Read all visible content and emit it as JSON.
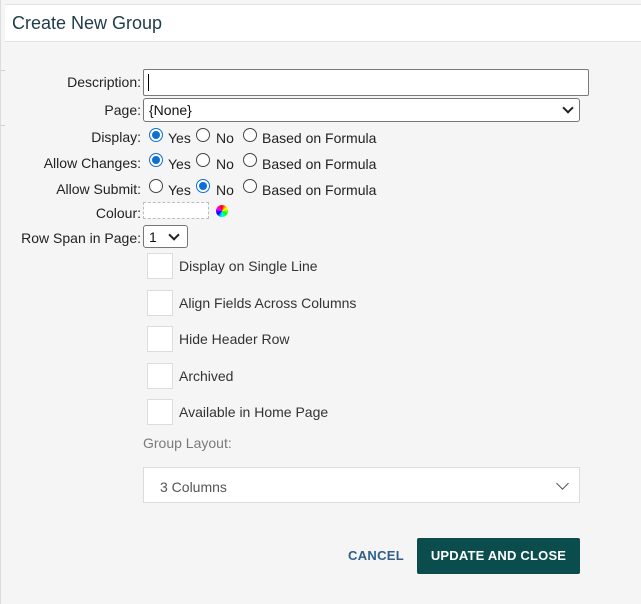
{
  "dialog": {
    "title": "Create New Group"
  },
  "form": {
    "description": {
      "label": "Description:",
      "value": ""
    },
    "page": {
      "label": "Page:",
      "selected": "{None}"
    },
    "display": {
      "label": "Display:",
      "options": [
        "Yes",
        "No",
        "Based on Formula"
      ],
      "selected": "Yes"
    },
    "allow_changes": {
      "label": "Allow Changes:",
      "options": [
        "Yes",
        "No",
        "Based on Formula"
      ],
      "selected": "Yes"
    },
    "allow_submit": {
      "label": "Allow Submit:",
      "options": [
        "Yes",
        "No",
        "Based on Formula"
      ],
      "selected": "No"
    },
    "colour": {
      "label": "Colour:"
    },
    "row_span": {
      "label": "Row Span in Page:",
      "selected": "1"
    },
    "checkboxes": [
      {
        "label": "Display on Single Line",
        "checked": false
      },
      {
        "label": "Align Fields Across Columns",
        "checked": false
      },
      {
        "label": "Hide Header Row",
        "checked": false
      },
      {
        "label": "Archived",
        "checked": false
      },
      {
        "label": "Available in Home Page",
        "checked": false
      }
    ],
    "group_layout": {
      "label": "Group Layout:",
      "selected": "3 Columns"
    }
  },
  "actions": {
    "cancel": "CANCEL",
    "update": "UPDATE AND CLOSE"
  },
  "colors": {
    "primary_button": "#0b4d4d",
    "radio_selected": "#0b6fd6",
    "cancel_text": "#2f5f8a"
  }
}
